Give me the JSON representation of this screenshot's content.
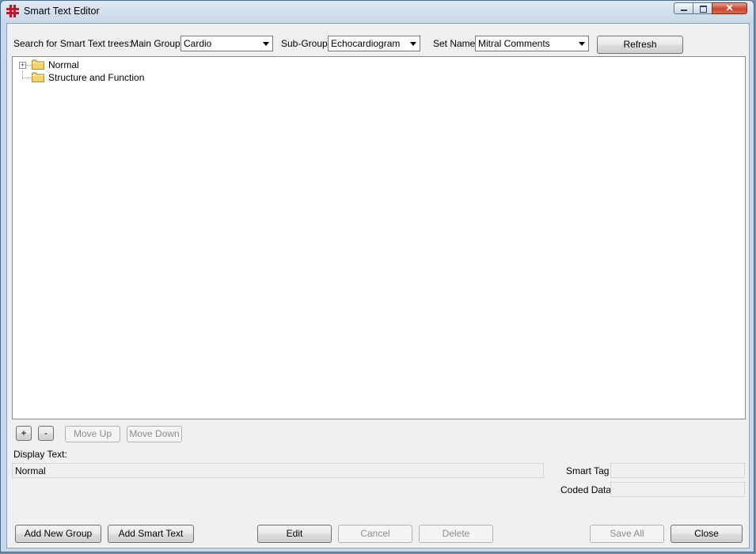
{
  "window": {
    "title": "Smart Text Editor",
    "close_glyph": "✕"
  },
  "search": {
    "label": "Search for Smart Text trees:",
    "main_group_label": "Main Group",
    "main_group_value": "Cardio",
    "sub_group_label": "Sub-Group",
    "sub_group_value": "Echocardiogram",
    "set_name_label": "Set Name",
    "set_name_value": "Mitral Comments",
    "refresh_label": "Refresh"
  },
  "tree": {
    "nodes": [
      {
        "label": "Normal",
        "expander": "+",
        "icon": "folder-icon"
      },
      {
        "label": "Structure and Function",
        "icon": "folder-icon"
      }
    ]
  },
  "node_buttons": {
    "add": "+",
    "remove": "-",
    "move_up": "Move Up",
    "move_down": "Move Down"
  },
  "details": {
    "display_text_label": "Display Text:",
    "display_text_value": "Normal",
    "smart_tag_label": "Smart Tag",
    "smart_tag_value": "",
    "coded_data_label": "Coded Data",
    "coded_data_value": ""
  },
  "footer": {
    "add_new_group": "Add New Group",
    "add_smart_text": "Add Smart Text",
    "edit": "Edit",
    "cancel": "Cancel",
    "delete": "Delete",
    "save_all": "Save All",
    "close": "Close"
  },
  "colors": {
    "folder": "#f5d36b",
    "app_icon": "#c8102e",
    "disabled_text": "#8d8d8d"
  }
}
